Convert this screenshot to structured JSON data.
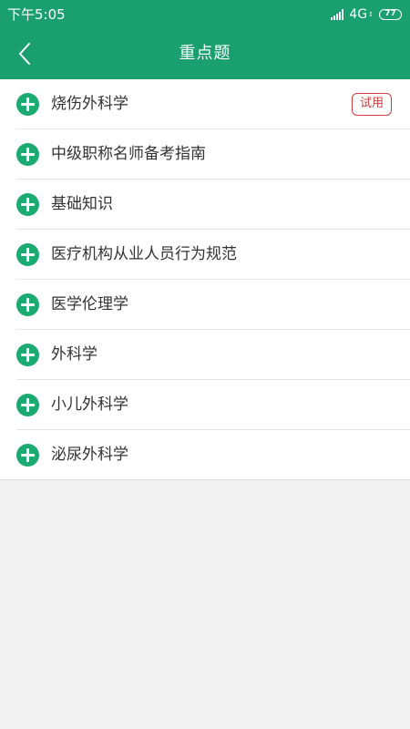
{
  "status_bar": {
    "time": "下午5:05",
    "network": "4G",
    "network_sub": "↕",
    "battery": "77"
  },
  "header": {
    "title": "重点题",
    "back_icon": "back-chevron-icon"
  },
  "colors": {
    "primary": "#1a9f6e",
    "plus_icon": "#1bab72",
    "badge": "#d63b3b",
    "background": "#f2f2f2"
  },
  "list": {
    "items": [
      {
        "label": "烧伤外科学",
        "badge": "试用"
      },
      {
        "label": "中级职称名师备考指南"
      },
      {
        "label": "基础知识"
      },
      {
        "label": "医疗机构从业人员行为规范"
      },
      {
        "label": "医学伦理学"
      },
      {
        "label": "外科学"
      },
      {
        "label": "小儿外科学"
      },
      {
        "label": "泌尿外科学"
      }
    ]
  }
}
